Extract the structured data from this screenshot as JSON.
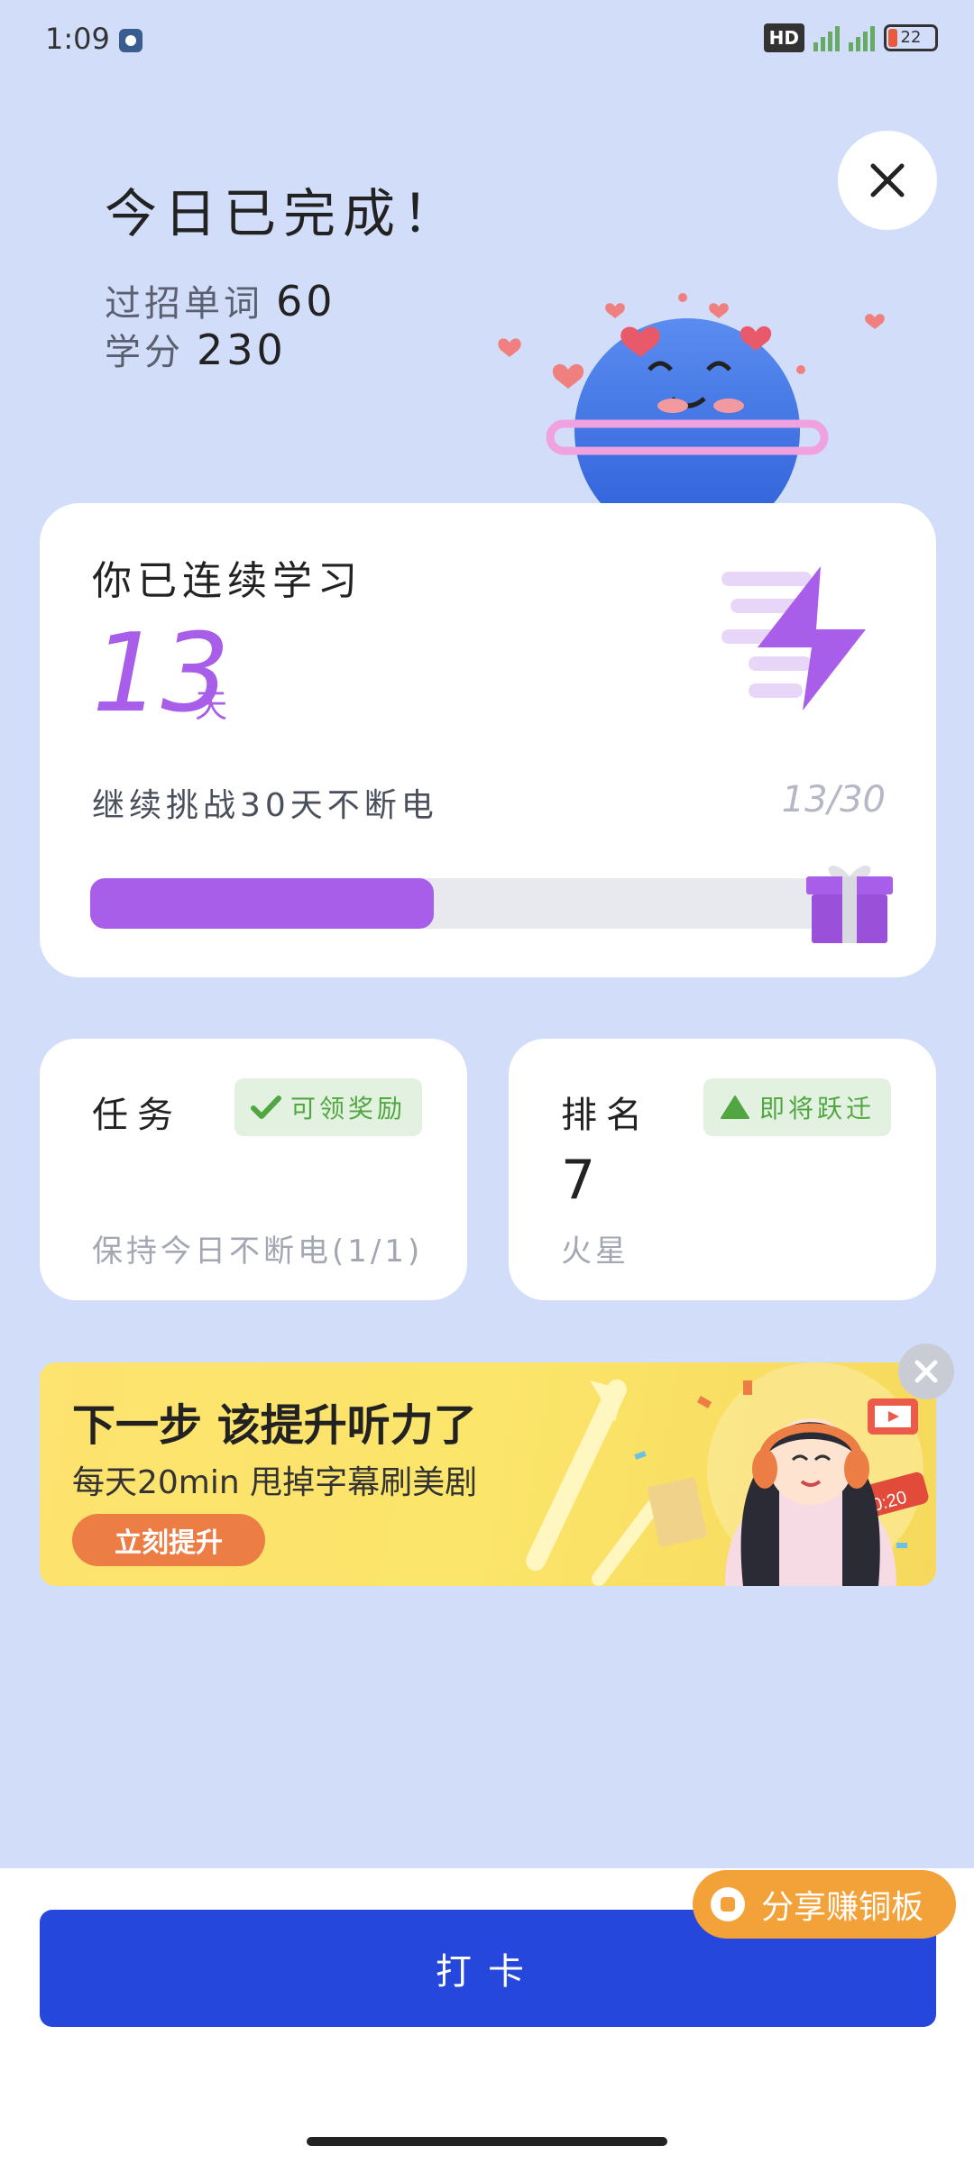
{
  "status_bar": {
    "time": "1:09",
    "hd": "HD",
    "battery": "22"
  },
  "header": {
    "title": "今日已完成！",
    "words_label": "过招单词",
    "words_value": "60",
    "credits_label": "学分",
    "credits_value": "230"
  },
  "streak": {
    "label": "你已连续学习",
    "days": "13",
    "unit": "天",
    "challenge": "继续挑战30天不断电",
    "progress_text": "13/30",
    "progress_fraction": 0.4333
  },
  "task_card": {
    "title": "任务",
    "chip": "可领奖励",
    "subtitle": "保持今日不断电(1/1)"
  },
  "rank_card": {
    "title": "排名",
    "chip": "即将跃迁",
    "value": "7",
    "subtitle": "火星"
  },
  "banner": {
    "title": "下一步 该提升听力了",
    "subtitle": "每天20min 甩掉字幕刷美剧",
    "button": "立刻提升",
    "timer_text": "00:20"
  },
  "share": {
    "label": "分享赚铜板"
  },
  "checkin": {
    "label": "打卡"
  },
  "colors": {
    "background": "#d2def9",
    "accent_purple": "#a85ee8",
    "primary_blue": "#2547db",
    "chip_green": "#52a642",
    "share_orange": "#f3a23a"
  }
}
